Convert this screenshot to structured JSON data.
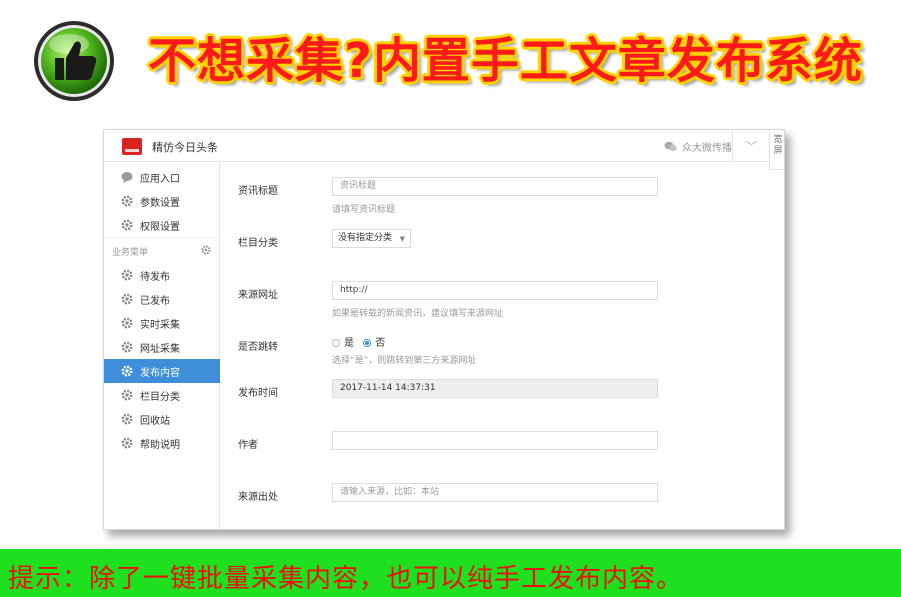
{
  "banner": {
    "title": "不想采集?内置手工文章发布系统",
    "logo_icon": "thumbs-up-icon"
  },
  "app": {
    "name": "精仿今日头条",
    "wechat_label": "众大微传播",
    "side_toggle_label": "宽屏"
  },
  "sidebar": {
    "items_top": [
      {
        "label": "应用入口",
        "icon": "chat-bubble-icon"
      },
      {
        "label": "参数设置",
        "icon": "gear-icon"
      },
      {
        "label": "权限设置",
        "icon": "gear-icon"
      }
    ],
    "section_label": "业务菜单",
    "items": [
      {
        "label": "待发布",
        "icon": "gear-icon"
      },
      {
        "label": "已发布",
        "icon": "gear-icon"
      },
      {
        "label": "实时采集",
        "icon": "gear-icon"
      },
      {
        "label": "网址采集",
        "icon": "gear-icon"
      },
      {
        "label": "发布内容",
        "icon": "gear-icon",
        "active": true
      },
      {
        "label": "栏目分类",
        "icon": "gear-icon"
      },
      {
        "label": "回收站",
        "icon": "gear-icon"
      },
      {
        "label": "帮助说明",
        "icon": "gear-icon"
      }
    ],
    "accent_color": "#3f8ed9"
  },
  "form": {
    "title": {
      "label": "资讯标题",
      "placeholder": "资讯标题",
      "help": "请填写资讯标题"
    },
    "category": {
      "label": "栏目分类",
      "selected": "没有指定分类"
    },
    "source_url": {
      "label": "来源网址",
      "value": "http://",
      "help": "如果是转载的新闻资讯，建议填写来源网址"
    },
    "redirect": {
      "label": "是否跳转",
      "option_yes": "是",
      "option_no": "否",
      "selected": "否",
      "help": "选择“是”，则跳转到第三方来源网址"
    },
    "publish_time": {
      "label": "发布时间",
      "value": "2017-11-14 14:37:31"
    },
    "author": {
      "label": "作者",
      "value": ""
    },
    "source": {
      "label": "来源出处",
      "placeholder": "请输入来源，比如：本站"
    }
  },
  "footer": {
    "text": "提示：除了一键批量采集内容，也可以纯手工发布内容。",
    "bg_color": "#1fe01f",
    "text_color": "#ee1010"
  }
}
